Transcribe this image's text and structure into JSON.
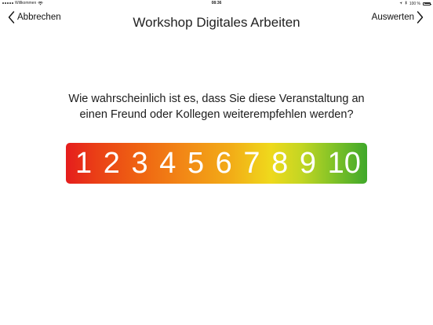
{
  "status_bar": {
    "carrier": "Willkommen",
    "time": "08:36",
    "battery_percent": "100 %"
  },
  "nav": {
    "back_label": "Abbrechen",
    "title": "Workshop Digitales Arbeiten",
    "forward_label": "Auswerten"
  },
  "question": {
    "line1": "Wie wahrscheinlich ist es, dass Sie diese Veranstaltung an",
    "line2": "einen Freund oder Kollegen weiterempfehlen werden?"
  },
  "rating": {
    "options": [
      "1",
      "2",
      "3",
      "4",
      "5",
      "6",
      "7",
      "8",
      "9",
      "10"
    ],
    "gradient_colors": [
      "#e51d1d",
      "#ef6512",
      "#f2ad17",
      "#efd91c",
      "#3fa82a"
    ]
  },
  "icons": {
    "back": "chevron-left-icon",
    "forward": "chevron-right-icon",
    "wifi": "wifi-icon",
    "bluetooth": "bluetooth-icon",
    "location": "location-arrow-icon",
    "battery": "battery-icon"
  }
}
